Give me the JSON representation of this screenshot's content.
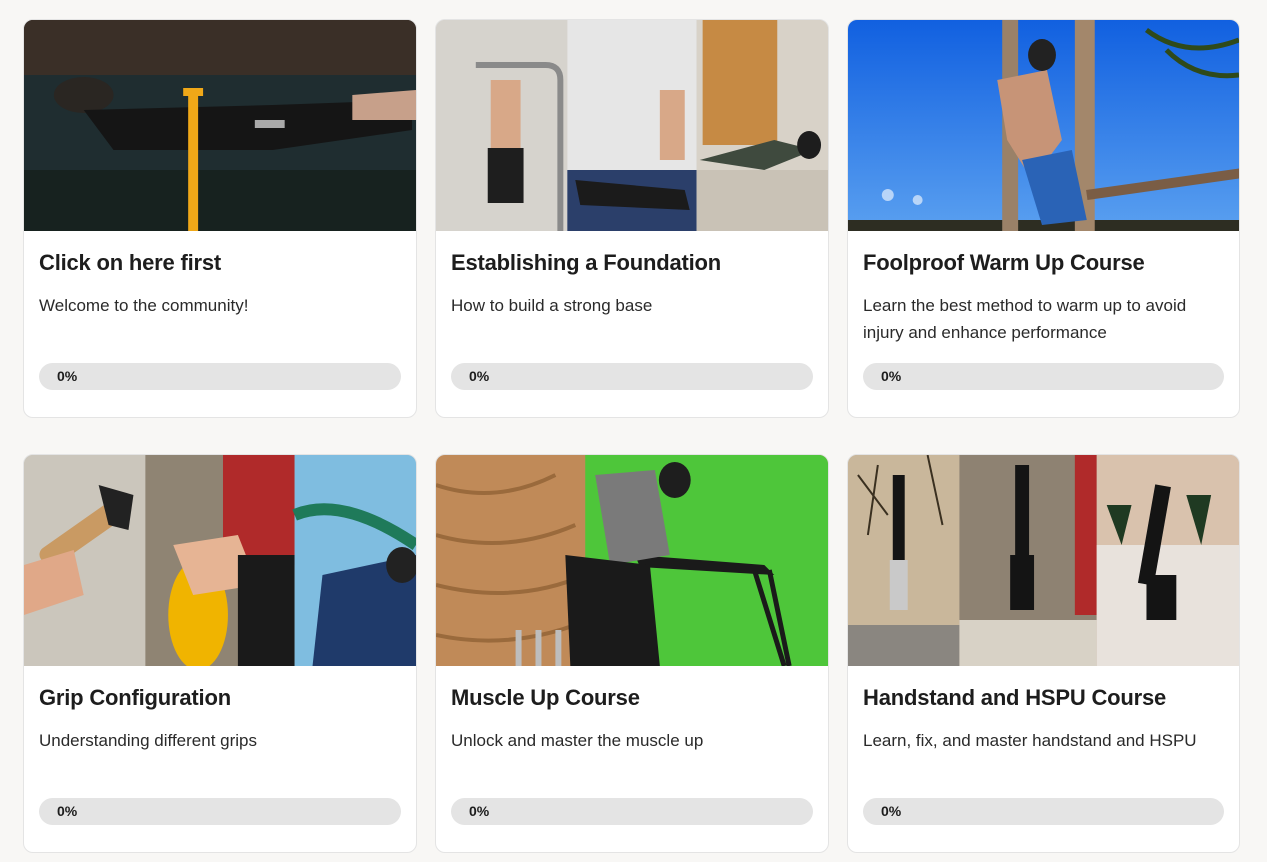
{
  "courses": [
    {
      "title": "Click on here first",
      "description": "Welcome to the community!",
      "progress_label": "0%",
      "progress": 0
    },
    {
      "title": "Establishing a Foundation",
      "description": "How to build a strong base",
      "progress_label": "0%",
      "progress": 0
    },
    {
      "title": "Foolproof Warm Up Course",
      "description": "Learn the best method to warm up to avoid injury and enhance performance",
      "progress_label": "0%",
      "progress": 0
    },
    {
      "title": "Grip Configuration",
      "description": "Understanding different grips",
      "progress_label": "0%",
      "progress": 0
    },
    {
      "title": "Muscle Up Course",
      "description": "Unlock and master the muscle up",
      "progress_label": "0%",
      "progress": 0
    },
    {
      "title": "Handstand and HSPU Course",
      "description": "Learn, fix, and master handstand and HSPU",
      "progress_label": "0%",
      "progress": 0
    }
  ],
  "colors": {
    "progress_track": "#e4e4e4",
    "progress_fill": "#f6c400"
  }
}
